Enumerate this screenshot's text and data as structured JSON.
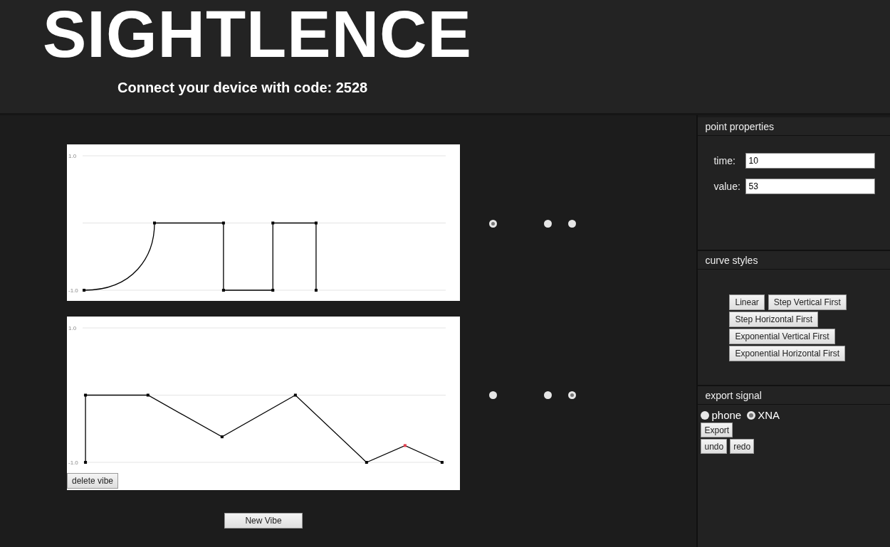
{
  "header": {
    "title": "SIGHTLENCE",
    "subtitle": "Connect your device with code: 2528"
  },
  "vibes": [
    {
      "axis_labels": [
        "1.0",
        "-1.0"
      ],
      "points": [
        {
          "selected": false
        },
        {
          "selected": false
        },
        {
          "selected": false
        },
        {
          "selected": false
        },
        {
          "selected": false
        },
        {
          "selected": false
        },
        {
          "selected": false
        },
        {
          "selected": false
        }
      ],
      "options": [
        {
          "selected": true
        },
        {
          "selected": false
        },
        {
          "selected": false
        }
      ]
    },
    {
      "axis_labels": [
        "1.0",
        "-1.0"
      ],
      "points": [
        {
          "selected": false
        },
        {
          "selected": false
        },
        {
          "selected": false
        },
        {
          "selected": false
        },
        {
          "selected": false
        },
        {
          "selected": false
        },
        {
          "selected": true
        },
        {
          "selected": false
        }
      ],
      "options": [
        {
          "selected": false
        },
        {
          "selected": false
        },
        {
          "selected": true
        }
      ],
      "delete_button": "delete vibe"
    }
  ],
  "new_button": "New Vibe",
  "sidebar": {
    "point_properties": {
      "heading": "point properties",
      "fields": [
        {
          "label": "time:",
          "value": "10"
        },
        {
          "label": "value:",
          "value": "53"
        }
      ]
    },
    "curve_styles": {
      "heading": "curve styles",
      "buttons": [
        "Linear",
        "Step Vertical First",
        "Step Horizontal First",
        "Exponential Vertical First",
        "Exponential Horizontal First"
      ]
    },
    "export_signal": {
      "heading": "export signal",
      "targets": [
        {
          "label": "phone",
          "selected": false
        },
        {
          "label": "XNA",
          "selected": true
        }
      ],
      "export_button": "Export",
      "undo_button": "undo",
      "redo_button": "redo"
    }
  }
}
